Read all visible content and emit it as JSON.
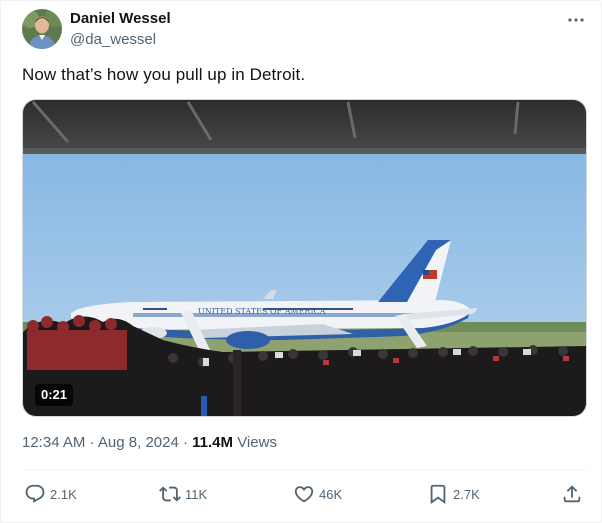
{
  "author": {
    "name": "Daniel Wessel",
    "handle": "@da_wessel"
  },
  "tweet": {
    "text": "Now that’s how you pull up in Detroit."
  },
  "video": {
    "duration": "0:21",
    "aircraft_text": "UNITED STATES OF AMERICA"
  },
  "meta": {
    "time": "12:34 AM",
    "separator": "·",
    "date": "Aug 8, 2024",
    "views_count": "11.4M",
    "views_label": "Views"
  },
  "actions": {
    "replies": "2.1K",
    "reposts": "11K",
    "likes": "46K",
    "bookmarks": "2.7K"
  },
  "colors": {
    "text_primary": "#0f1419",
    "text_secondary": "#536471",
    "border": "#eff3f4"
  },
  "icons": [
    "more-icon",
    "reply-icon",
    "repost-icon",
    "like-icon",
    "bookmark-icon",
    "share-icon"
  ]
}
